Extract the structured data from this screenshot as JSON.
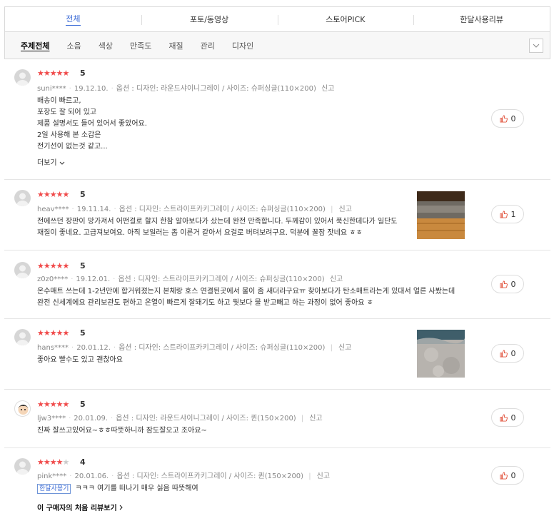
{
  "tabs": [
    "전체",
    "포토/동영상",
    "스토어PICK",
    "한달사용리뷰"
  ],
  "subfilters": [
    "주제전체",
    "소음",
    "색상",
    "만족도",
    "재질",
    "관리",
    "디자인"
  ],
  "reviews": [
    {
      "rating": 5,
      "score": "5",
      "user": "suni****",
      "date": "19.12.10.",
      "option": "옵션 : 디자인: 라운드샤이니그레이 / 사이즈: 슈퍼싱글(110×200)",
      "report": "신고",
      "lines": [
        "배송이 빠르고,",
        "포장도 잘 되어 있고",
        "제품 설명서도 들어 있어서 좋았어요.",
        "2일 사용해 본 소감은",
        "전기선이 없는것 같고..."
      ],
      "more": "더보기",
      "likes": "0"
    },
    {
      "rating": 5,
      "score": "5",
      "user": "heav****",
      "date": "19.11.14.",
      "option": "옵션 : 디자인: 스트라이프카키그레이 / 사이즈: 슈퍼싱글(110×200)",
      "report": "신고",
      "lines": [
        "전에쓰던 장판이 망가져서 어떤걸로 할지 한참 알아보다가 샀는데 완전 만족합니다. 두께감이 있어서 푹신한데다가 일단도",
        "재질이 좋네요. 고급져보여요. 아직 보일러는 좀 이른거 같아서 요걸로 버텨보려구요. 덕분에 꿀잠 잣네요 ㅎㅎ"
      ],
      "likes": "1",
      "photo": "sofa-photo"
    },
    {
      "rating": 5,
      "score": "5",
      "user": "z0z0****",
      "date": "19.12.01.",
      "option": "옵션 : 디자인: 스트라이프카키그레이 / 사이즈: 슈퍼싱글(110×200)",
      "report": "신고",
      "lines": [
        "온수매트 쓰는데 1-2년만에 합거워졌는지 본체랑 호스 연결된곳에서 물이 좀 새더라구요ㅠ 찾아보다가 탄소매트라는게 있대서 얼른 사봤는데",
        "완전 신세계에요 관리보관도 편하고 온열이 빠르게 잘돼기도 하고 뭣보다 물 받고빼고 하는 과정이 없어 좋아요 ㅎ"
      ],
      "likes": "0"
    },
    {
      "rating": 5,
      "score": "5",
      "user": "hans****",
      "date": "20.01.12.",
      "option": "옵션 : 디자인: 스트라이프카키그레이 / 사이즈: 슈퍼싱글(110×200)",
      "report": "신고",
      "lines": [
        "좋아요 빨수도 있고 괜찮아요"
      ],
      "likes": "0",
      "photo": "mat-photo"
    },
    {
      "rating": 5,
      "score": "5",
      "user": "ljw3****",
      "date": "20.01.09.",
      "option": "옵션 : 디자인: 라운드샤이니그레이 / 사이즈: 퀸(150×200)",
      "report": "신고",
      "lines": [
        "진짜 잘쓰고있어요~ㅎㅎ따뜻하니까 잠도잘오고 조아요~"
      ],
      "likes": "0"
    },
    {
      "rating": 4,
      "score": "4",
      "user": "pink****",
      "date": "20.01.06.",
      "option": "옵션 : 디자인: 스트라이프카키그레이 / 사이즈: 퀸(150×200)",
      "report": "신고",
      "tag": "한달사용기",
      "lines": [
        "ㅋㅋㅋ 여기를 떠나기 매우 싫음 따뜻해여"
      ],
      "first_review_link": "이 구매자의 처음 리뷰보기",
      "likes": "0"
    }
  ]
}
